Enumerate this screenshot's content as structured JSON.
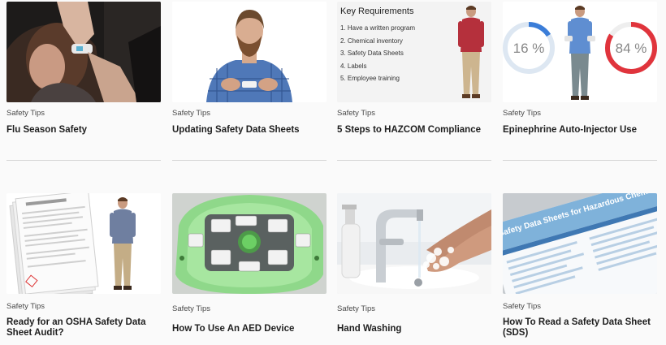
{
  "cards": [
    {
      "category": "Safety Tips",
      "title": "Flu Season Safety",
      "image": "woman-thermometer-ear-photo"
    },
    {
      "category": "Safety Tips",
      "title": "Updating Safety Data Sheets",
      "image": "man-plaid-shirt-presenter"
    },
    {
      "category": "Safety Tips",
      "title": "5 Steps to HAZCOM Compliance",
      "image": "key-requirements-slide",
      "slide": {
        "heading": "Key Requirements",
        "items": [
          "1. Have a written program",
          "2. Chemical inventory",
          "3. Safety Data Sheets",
          "4. Labels",
          "5. Employee training"
        ]
      }
    },
    {
      "category": "Safety Tips",
      "title": "Epinephrine Auto-Injector Use",
      "image": "presenter-with-percent-rings",
      "stats": {
        "left": "16 %",
        "right": "84 %",
        "left_value": 16,
        "right_value": 84,
        "left_color": "#3b7dd8",
        "right_color": "#e0343c"
      }
    },
    {
      "category": "Safety Tips",
      "title": "Ready for an OSHA Safety Data Sheet Audit?",
      "image": "sds-sheets-presenter"
    },
    {
      "category": "Safety Tips",
      "title": "How To Use An AED Device",
      "image": "green-aed-device-photo"
    },
    {
      "category": "Safety Tips",
      "title": "Hand Washing",
      "image": "hand-washing-sink-photo"
    },
    {
      "category": "Safety Tips",
      "title": "How To Read a Safety Data Sheet (SDS)",
      "image": "safety-data-sheet-document-photo",
      "doc_heading": "Safety Data Sheets for Hazardous Chemicals"
    }
  ]
}
